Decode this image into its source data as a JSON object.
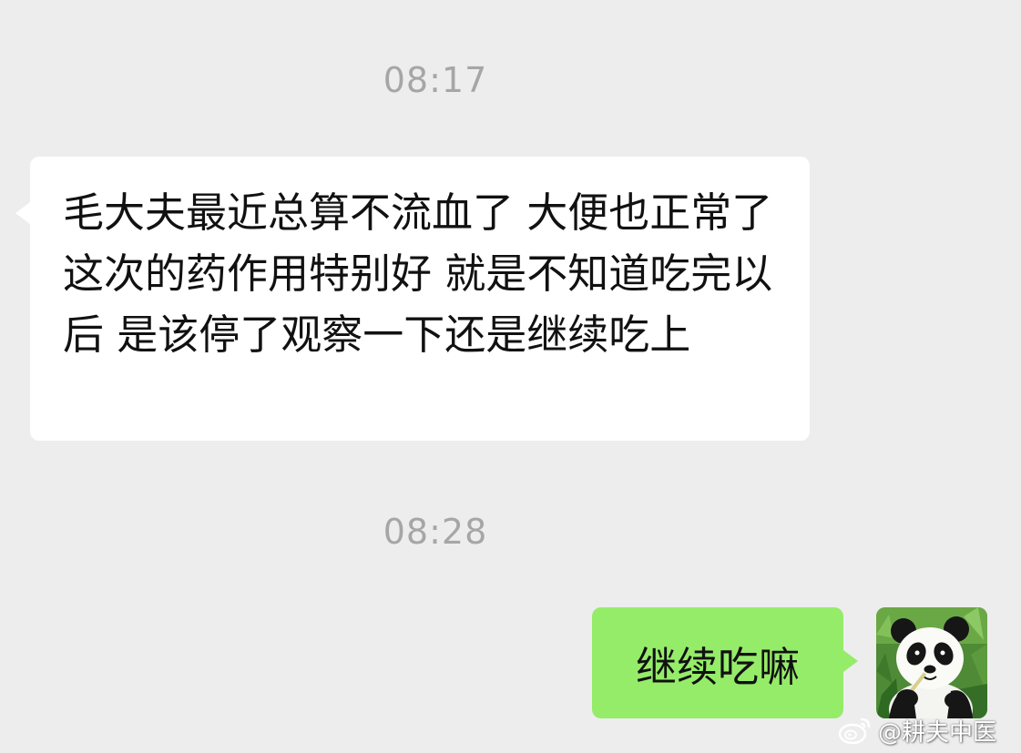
{
  "chat": {
    "messages": [
      {
        "timestamp": "08:17",
        "sender": "contact",
        "text": "毛大夫最近总算不流血了 大便也正常了 这次的药作用特别好 就是不知道吃完以后 是该停了观察一下还是继续吃上"
      },
      {
        "timestamp": "08:28",
        "sender": "self",
        "text": "继续吃嘛"
      }
    ],
    "self_avatar": "panda-avatar"
  },
  "watermark": {
    "icon": "weibo-icon",
    "text": "@耕夫中医"
  },
  "colors": {
    "background": "#ededed",
    "incoming_bubble": "#ffffff",
    "outgoing_bubble": "#95ec69",
    "timestamp_text": "#a6a6a6"
  }
}
